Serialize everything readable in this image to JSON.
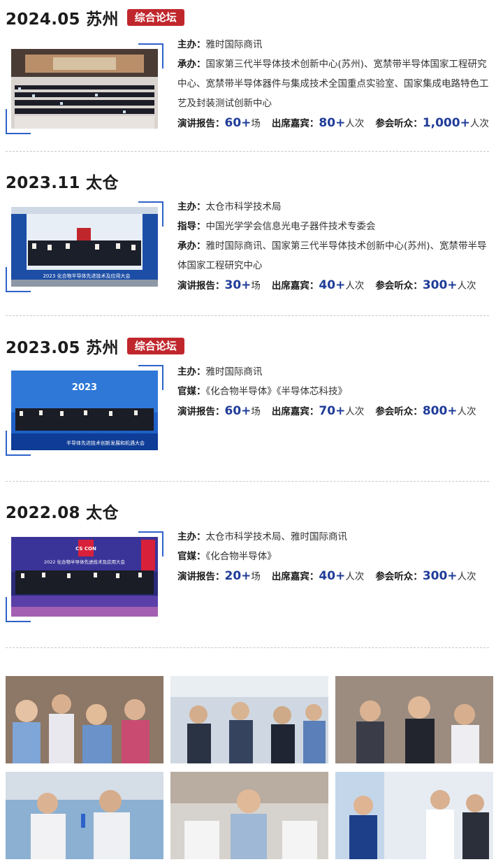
{
  "events": [
    {
      "date_city": "2024.05  苏州",
      "badge": "综合论坛",
      "rows": [
        {
          "label": "主办：",
          "value": "雅时国际商讯"
        },
        {
          "label": "承办：",
          "value": "国家第三代半导体技术创新中心(苏州)、宽禁带半导体国家工程研究中心、宽禁带半导体器件与集成技术全国重点实验室、国家集成电路特色工艺及封装测试创新中心"
        }
      ],
      "stats": {
        "talks_label": "演讲报告：",
        "talks": "60+",
        "talks_unit": "场",
        "guests_label": "出席嘉宾：",
        "guests": "80+",
        "guests_unit": "人次",
        "audience_label": "参会听众：",
        "audience": "1,000+",
        "audience_unit": "人次"
      }
    },
    {
      "date_city": "2023.11  太仓",
      "badge": "",
      "banner": "2023 化合物半导体先进技术及应用大会",
      "rows": [
        {
          "label": "主办：",
          "value": "太仓市科学技术局"
        },
        {
          "label": "指导：",
          "value": "中国光学学会信息光电子器件技术专委会"
        },
        {
          "label": "承办：",
          "value": "雅时国际商讯、国家第三代半导体技术创新中心(苏州)、宽禁带半导体国家工程研究中心"
        }
      ],
      "stats": {
        "talks_label": "演讲报告：",
        "talks": "30+",
        "talks_unit": "场",
        "guests_label": "出席嘉宾：",
        "guests": "40+",
        "guests_unit": "人次",
        "audience_label": "参会听众：",
        "audience": "300+",
        "audience_unit": "人次"
      }
    },
    {
      "date_city": "2023.05  苏州",
      "badge": "综合论坛",
      "banner": "2023",
      "banner2": "半导体先进技术创新发展和机遇大会",
      "rows": [
        {
          "label": "主办：",
          "value": "雅时国际商讯"
        },
        {
          "label": "官媒：",
          "value": "《化合物半导体》《半导体芯科技》"
        }
      ],
      "stats": {
        "talks_label": "演讲报告：",
        "talks": "60+",
        "talks_unit": "场",
        "guests_label": "出席嘉宾：",
        "guests": "70+",
        "guests_unit": "人次",
        "audience_label": "参会听众：",
        "audience": "800+",
        "audience_unit": "人次"
      }
    },
    {
      "date_city": "2022.08  太仓",
      "badge": "",
      "banner": "2022 化合物半导体先进技术及应用大会",
      "logo": "CS CON",
      "rows": [
        {
          "label": "主办：",
          "value": "太仓市科学技术局、雅时国际商讯"
        },
        {
          "label": "官媒：",
          "value": "《化合物半导体》"
        }
      ],
      "stats": {
        "talks_label": "演讲报告：",
        "talks": "20+",
        "talks_unit": "场",
        "guests_label": "出席嘉宾：",
        "guests": "40+",
        "guests_unit": "人次",
        "audience_label": "参会听众：",
        "audience": "300+",
        "audience_unit": "人次"
      }
    }
  ],
  "colors": {
    "accent_red": "#c0272d",
    "accent_blue": "#1f3c98",
    "frame_blue": "#2d62c8"
  }
}
